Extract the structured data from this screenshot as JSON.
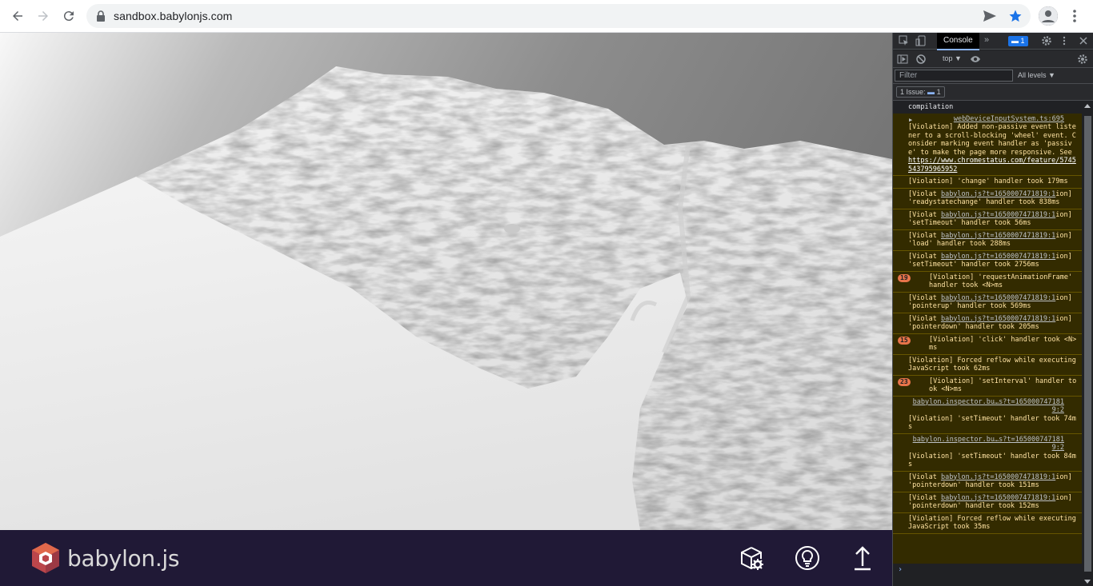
{
  "browser": {
    "url": "sandbox.babylonjs.com",
    "icons": [
      "back-arrow-icon",
      "forward-arrow-icon",
      "reload-icon",
      "lock-icon",
      "send-icon",
      "bookmark-star-icon",
      "profile-icon",
      "menu-kebab-icon"
    ]
  },
  "footer": {
    "logo_text": "babylon.js",
    "buttons": [
      "inspector-icon",
      "lightbulb-icon",
      "upload-icon"
    ],
    "background": "#201936"
  },
  "devtools": {
    "active_tab": "Console",
    "messages_badge": "1",
    "context": "top ▼",
    "filter_placeholder": "Filter",
    "levels": "All levels ▼",
    "issues_label": "1 Issue:",
    "issues_count": "1",
    "log": [
      {
        "kind": "plain",
        "text": "compilation"
      },
      {
        "kind": "warn",
        "src": "webDeviceInputSystem.ts:695",
        "text": "[Violation] Added non-passive event listener to a scroll-blocking 'wheel' event. Consider marking event handler as 'passive' to make the page more responsive. See ",
        "link": "https://www.chromestatus.com/feature/5745543795965952"
      },
      {
        "kind": "warn",
        "text": "[Violation] 'change' handler took 179ms"
      },
      {
        "kind": "warn",
        "text": "[Violat ",
        "src": "babylon.js?t=1650007471819:1",
        "text2": "ion] 'readystatechange' handler took 838ms"
      },
      {
        "kind": "warn",
        "text": "[Violat ",
        "src": "babylon.js?t=1650007471819:1",
        "text2": "ion] 'setTimeout' handler took 56ms"
      },
      {
        "kind": "warn",
        "text": "[Violat ",
        "src": "babylon.js?t=1650007471819:1",
        "text2": "ion] 'load' handler took 288ms"
      },
      {
        "kind": "warn",
        "text": "[Violat ",
        "src": "babylon.js?t=1650007471819:1",
        "text2": "ion] 'setTimeout' handler took 2756ms"
      },
      {
        "kind": "count",
        "count": "19",
        "text": "[Violation] 'requestAnimationFrame' handler took <N>ms"
      },
      {
        "kind": "warn",
        "text": "[Violat ",
        "src": "babylon.js?t=1650007471819:1",
        "text2": "ion] 'pointerup' handler took 569ms"
      },
      {
        "kind": "warn",
        "text": "[Violat ",
        "src": "babylon.js?t=1650007471819:1",
        "text2": "ion] 'pointerdown' handler took 205ms"
      },
      {
        "kind": "count",
        "count": "15",
        "text": "[Violation] 'click' handler took <N>ms"
      },
      {
        "kind": "warn",
        "text": "[Violation] Forced reflow while executing JavaScript took 62ms"
      },
      {
        "kind": "count",
        "count": "23",
        "text": "[Violation] 'setInterval' handler took <N>ms"
      },
      {
        "kind": "srcfirst",
        "src": "babylon.inspector.bu…s?t=1650007471819:2",
        "text": "[Violation] 'setTimeout' handler took 74ms"
      },
      {
        "kind": "srcfirst",
        "src": "babylon.inspector.bu…s?t=1650007471819:2",
        "text": "[Violation] 'setTimeout' handler took 84ms"
      },
      {
        "kind": "warn",
        "text": "[Violat ",
        "src": "babylon.js?t=1650007471819:1",
        "text2": "ion] 'pointerdown' handler took 151ms"
      },
      {
        "kind": "warn",
        "text": "[Violat ",
        "src": "babylon.js?t=1650007471819:1",
        "text2": "ion] 'pointerdown' handler took 152ms"
      },
      {
        "kind": "warn",
        "text": "[Violation] Forced reflow while executing JavaScript took 35ms"
      }
    ],
    "prompt": "›"
  }
}
